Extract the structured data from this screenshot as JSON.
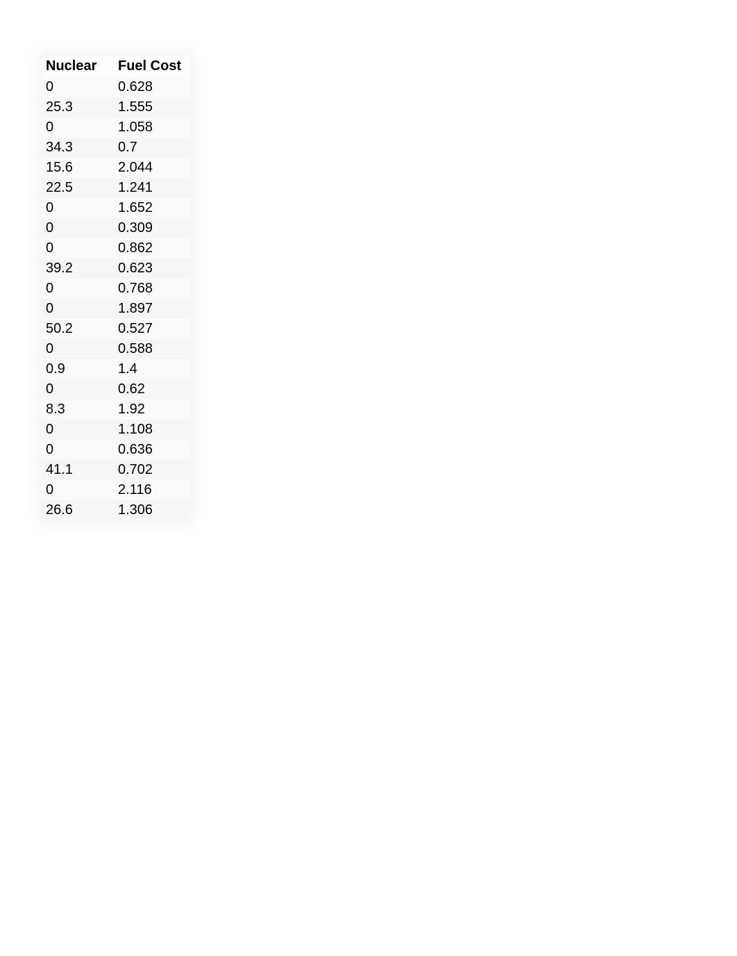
{
  "table": {
    "headers": [
      "Nuclear",
      "Fuel Cost"
    ],
    "rows": [
      [
        "0",
        "0.628"
      ],
      [
        "25.3",
        "1.555"
      ],
      [
        "0",
        "1.058"
      ],
      [
        "34.3",
        "0.7"
      ],
      [
        "15.6",
        "2.044"
      ],
      [
        "22.5",
        "1.241"
      ],
      [
        "0",
        "1.652"
      ],
      [
        "0",
        "0.309"
      ],
      [
        "0",
        "0.862"
      ],
      [
        "39.2",
        "0.623"
      ],
      [
        "0",
        "0.768"
      ],
      [
        "0",
        "1.897"
      ],
      [
        "50.2",
        "0.527"
      ],
      [
        "0",
        "0.588"
      ],
      [
        "0.9",
        "1.4"
      ],
      [
        "0",
        "0.62"
      ],
      [
        "8.3",
        "1.92"
      ],
      [
        "0",
        "1.108"
      ],
      [
        "0",
        "0.636"
      ],
      [
        "41.1",
        "0.702"
      ],
      [
        "0",
        "2.116"
      ],
      [
        "26.6",
        "1.306"
      ]
    ]
  }
}
